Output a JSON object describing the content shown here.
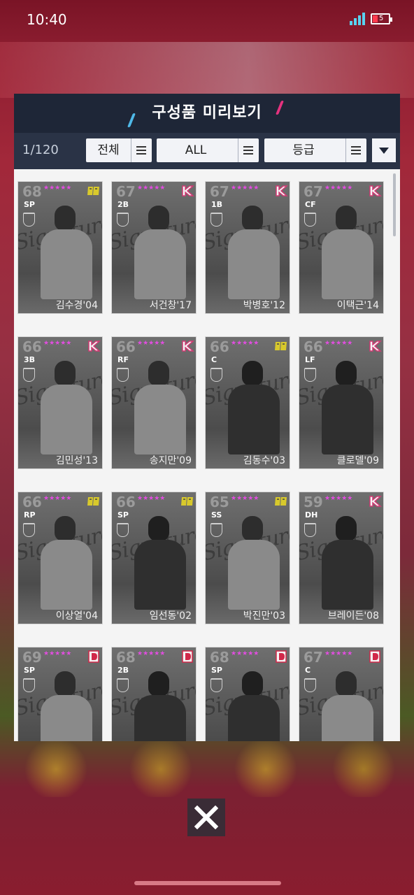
{
  "status": {
    "time": "10:40",
    "battery_level": "5"
  },
  "modal": {
    "title": "구성품 미리보기",
    "count": "1/120",
    "filters": [
      {
        "label": "전체"
      },
      {
        "label": "ALL"
      },
      {
        "label": "등급"
      }
    ]
  },
  "cards": [
    {
      "rating": "68",
      "position": "SP",
      "name": "김수경'04",
      "team": "hd-logo-icon",
      "tone": "light"
    },
    {
      "rating": "67",
      "position": "2B",
      "name": "서건창'17",
      "team": "k-logo-icon",
      "tone": "light"
    },
    {
      "rating": "67",
      "position": "1B",
      "name": "박병호'12",
      "team": "k-logo-icon",
      "tone": "light"
    },
    {
      "rating": "67",
      "position": "CF",
      "name": "이택근'14",
      "team": "k-logo-icon",
      "tone": "light"
    },
    {
      "rating": "66",
      "position": "3B",
      "name": "김민성'13",
      "team": "k-logo-icon",
      "tone": "light"
    },
    {
      "rating": "66",
      "position": "RF",
      "name": "송지만'09",
      "team": "k-logo-icon",
      "tone": "light"
    },
    {
      "rating": "66",
      "position": "C",
      "name": "김동수'03",
      "team": "hd-logo-icon",
      "tone": "dark"
    },
    {
      "rating": "66",
      "position": "LF",
      "name": "클로델'09",
      "team": "k-logo-icon",
      "tone": "dark"
    },
    {
      "rating": "66",
      "position": "RP",
      "name": "이상열'04",
      "team": "hd-logo-icon",
      "tone": "light"
    },
    {
      "rating": "66",
      "position": "SP",
      "name": "임선동'02",
      "team": "hd-logo-icon",
      "tone": "dark"
    },
    {
      "rating": "65",
      "position": "SS",
      "name": "박진만'03",
      "team": "hd-logo-icon",
      "tone": "light"
    },
    {
      "rating": "59",
      "position": "DH",
      "name": "브레이든'08",
      "team": "k-logo-icon",
      "tone": "dark"
    },
    {
      "rating": "69",
      "position": "SP",
      "name": "",
      "team": "d-logo-icon",
      "tone": "light"
    },
    {
      "rating": "68",
      "position": "2B",
      "name": "",
      "team": "d-logo-icon",
      "tone": "dark"
    },
    {
      "rating": "68",
      "position": "SP",
      "name": "",
      "team": "d-logo-icon",
      "tone": "dark"
    },
    {
      "rating": "67",
      "position": "C",
      "name": "",
      "team": "d-logo-icon",
      "tone": "light"
    }
  ],
  "stars": "★★★★★",
  "signature_text": "Signature",
  "colors": {
    "accent_pink": "#e24de0",
    "header_bg": "#1e2637",
    "filter_bg": "#2a3346"
  }
}
